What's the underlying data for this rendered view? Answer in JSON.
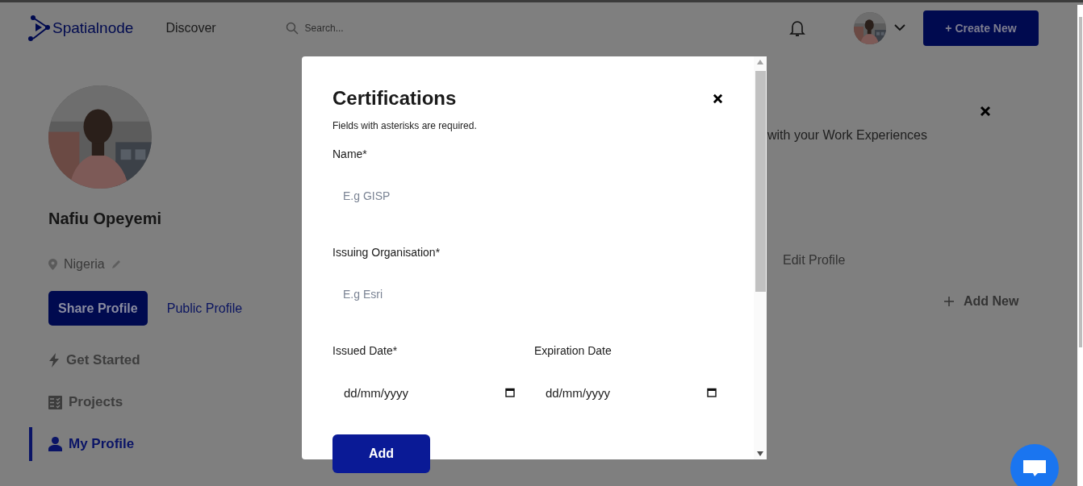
{
  "header": {
    "logo": "Spatialnode",
    "nav": [
      {
        "label": "Discover"
      }
    ],
    "search": {
      "placeholder": "Search..."
    },
    "create_button": "+ Create New"
  },
  "profile": {
    "name": "Nafiu Opeyemi",
    "location": "Nigeria",
    "share_button": "Share Profile",
    "public_link": "Public Profile"
  },
  "sidebar": {
    "items": [
      {
        "label": "Get Started",
        "kind": "bolt",
        "selected": false
      },
      {
        "label": "Projects",
        "kind": "checklist",
        "selected": false
      },
      {
        "label": "My Profile",
        "kind": "person",
        "selected": true
      }
    ]
  },
  "background_panel": {
    "text": "with your Work Experiences",
    "edit_link": "Edit Profile",
    "add_new": "Add New"
  },
  "modal": {
    "title": "Certifications",
    "note": "Fields with asterisks are required.",
    "fields": [
      {
        "label": "Name*",
        "placeholder": "E.g GISP",
        "kind": "text"
      },
      {
        "label": "Issuing Organisation*",
        "placeholder": "E.g Esri",
        "kind": "text"
      },
      {
        "label": "Issued Date*",
        "value": "dd/mm/yyyy",
        "kind": "date"
      },
      {
        "label": "Expiration Date",
        "value": "dd/mm/yyyy",
        "kind": "date"
      }
    ],
    "submit": "Add"
  }
}
